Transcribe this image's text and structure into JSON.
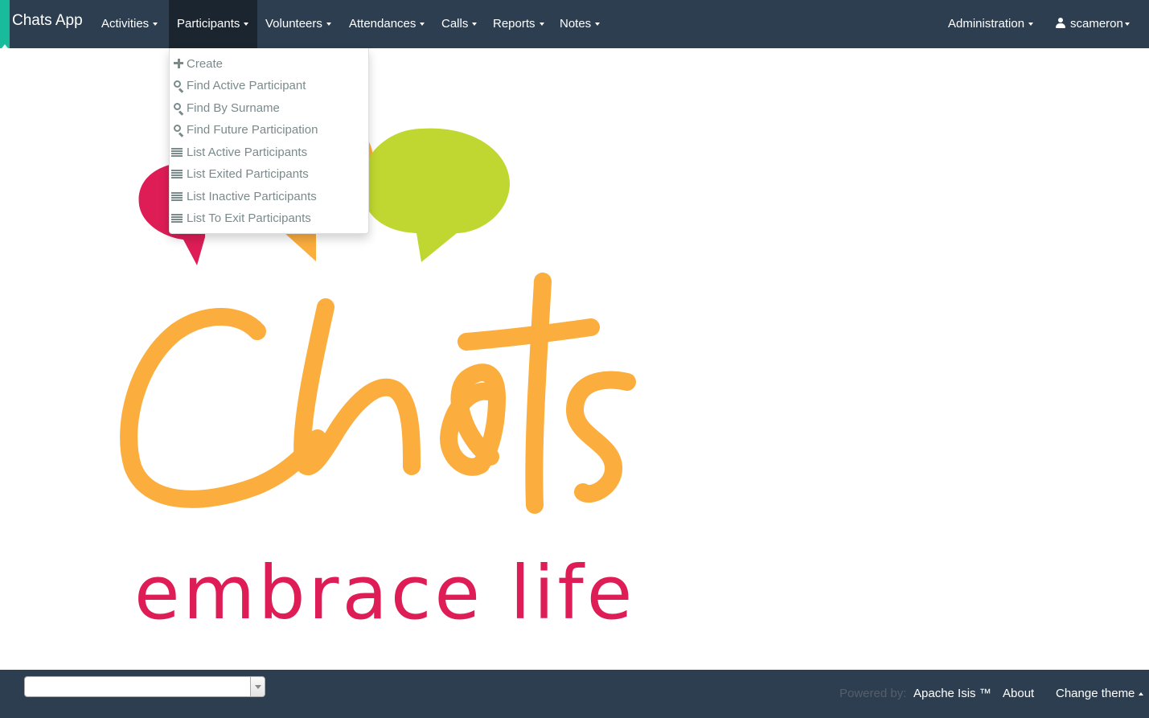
{
  "app": {
    "brand": "Chats App"
  },
  "nav": {
    "menus": [
      {
        "label": "Activities"
      },
      {
        "label": "Participants"
      },
      {
        "label": "Volunteers"
      },
      {
        "label": "Attendances"
      },
      {
        "label": "Calls"
      },
      {
        "label": "Reports"
      },
      {
        "label": "Notes"
      }
    ],
    "right": {
      "administration": "Administration",
      "user": "scameron"
    }
  },
  "participants_menu": {
    "items": [
      {
        "icon": "plus-icon",
        "label": "Create"
      },
      {
        "icon": "search-icon",
        "label": "Find Active Participant"
      },
      {
        "icon": "search-icon",
        "label": "Find By Surname"
      },
      {
        "icon": "search-icon",
        "label": "Find Future Participation"
      },
      {
        "icon": "list-icon",
        "label": "List Active Participants"
      },
      {
        "icon": "list-icon",
        "label": "List Exited Participants"
      },
      {
        "icon": "list-icon",
        "label": "List Inactive Participants"
      },
      {
        "icon": "list-icon",
        "label": "List To Exit Participants"
      }
    ]
  },
  "logo": {
    "wordmark": "Chats",
    "tagline": "embrace life",
    "colors": {
      "red": "#de1d57",
      "orange": "#fbad3d",
      "green": "#bfd730"
    }
  },
  "footer": {
    "select_value": "",
    "powered_by_label": "Powered by:",
    "powered_by_link": "Apache Isis ™",
    "about": "About",
    "change_theme": "Change theme"
  },
  "colors": {
    "navbar": "#2c3e50",
    "navbar_active": "#1a252f",
    "brand_accent": "#18bc9c",
    "menu_text": "#7b8a8b"
  }
}
